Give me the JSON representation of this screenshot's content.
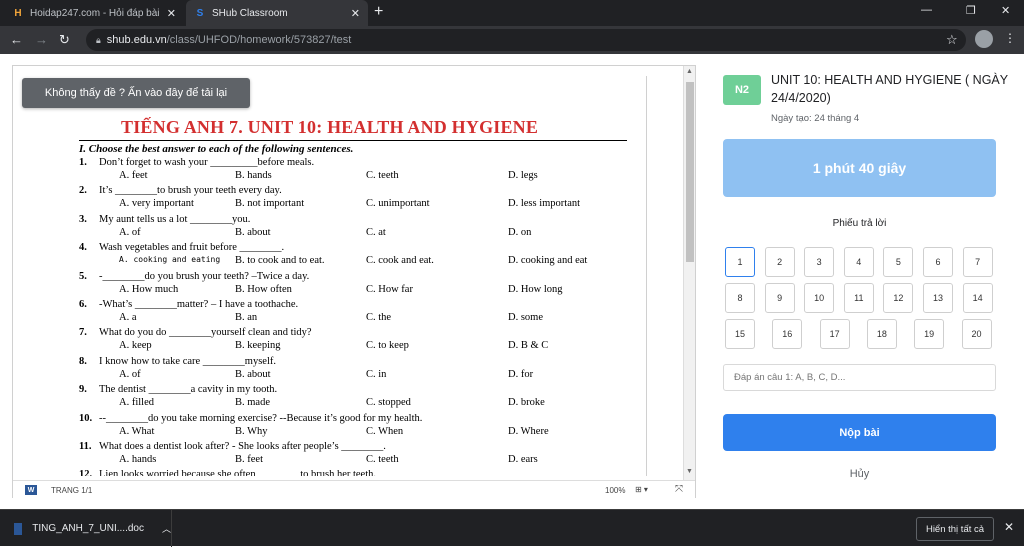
{
  "browser": {
    "tabs": [
      {
        "label": "Hoidap247.com - Hỏi đáp bài tập",
        "favicon": "H"
      },
      {
        "label": "SHub Classroom",
        "favicon": "S"
      }
    ],
    "url_domain": "shub.edu.vn",
    "url_path": "/class/UHFOD/homework/573827/test"
  },
  "viewer": {
    "reload_notice": "Không thấy đề ? Ấn vào đây để tải lại",
    "doc_title": "TIẾNG ANH 7. UNIT 10: HEALTH AND HYGIENE",
    "instruction": "I. Choose the best answer to each of the following sentences.",
    "questions": [
      {
        "num": "1.",
        "text": "Don’t forget to wash your _________before meals.",
        "options": [
          "A. feet",
          "B. hands",
          "C. teeth",
          "D. legs"
        ]
      },
      {
        "num": "2.",
        "text": "It’s ________to brush your teeth every day.",
        "options": [
          "A. very important",
          "B. not important",
          "C. unimportant",
          "D. less important"
        ]
      },
      {
        "num": "3.",
        "text": "My aunt tells us a lot ________you.",
        "options": [
          "A. of",
          "B. about",
          "C. at",
          "D. on"
        ]
      },
      {
        "num": "4.",
        "text": "Wash vegetables and fruit before ________.",
        "options": [
          "A. cooking and eating",
          "B. to cook and to eat.",
          "C. cook and eat.",
          "D. cooking and eat"
        ]
      },
      {
        "num": "5.",
        "text": "-________do you brush your teeth? –Twice a day.",
        "options": [
          "A. How much",
          "B. How often",
          "C. How far",
          "D. How long"
        ]
      },
      {
        "num": "6.",
        "text": "-What’s ________matter? – I have a toothache.",
        "options": [
          "A. a",
          "B. an",
          "C. the",
          "D. some"
        ]
      },
      {
        "num": "7.",
        "text": "What do you do ________yourself clean and tidy?",
        "options": [
          "A. keep",
          "B. keeping",
          "C. to keep",
          "D. B & C"
        ]
      },
      {
        "num": "8.",
        "text": "I know how to take care ________myself.",
        "options": [
          "A. of",
          "B. about",
          "C. in",
          "D. for"
        ]
      },
      {
        "num": "9.",
        "text": "The dentist ________a cavity in my tooth.",
        "options": [
          "A. filled",
          "B. made",
          "C. stopped",
          "D. broke"
        ]
      },
      {
        "num": "10.",
        "text": "--________do you take morning exercise? --Because it’s good for my health.",
        "options": [
          "A. What",
          "B. Why",
          "C. When",
          "D. Where"
        ]
      },
      {
        "num": "11.",
        "text": "What does a dentist look after? - She looks after people’s ________.",
        "options": [
          "A. hands",
          "B. feet",
          "C. teeth",
          "D. ears"
        ]
      },
      {
        "num": "12.",
        "text": "Lien looks worried because she often ________to brush her teeth.",
        "options": []
      }
    ],
    "page_indicator": "TRANG 1/1",
    "zoom": "100%"
  },
  "panel": {
    "badge": "N2",
    "title": "UNIT 10: HEALTH AND HYGIENE ( NGÀY 24/4/2020)",
    "created": "Ngày tạo: 24 tháng 4",
    "timer": "1 phút 40 giây",
    "sheet_label": "Phiếu trả lời",
    "answer_numbers": [
      "1",
      "2",
      "3",
      "4",
      "5",
      "6",
      "7",
      "8",
      "9",
      "10",
      "11",
      "12",
      "13",
      "14",
      "15",
      "16",
      "17",
      "18",
      "19",
      "20"
    ],
    "answer_placeholder": "Đáp án câu 1: A, B, C, D...",
    "submit_label": "Nộp bài",
    "cancel_label": "Hủy"
  },
  "downloads": {
    "file_name": "TING_ANH_7_UNI....doc",
    "show_all": "Hiển thị tất cả"
  },
  "colors": {
    "accent": "#2f80ed",
    "timer": "#8fc1f2",
    "badge": "#6fcf97",
    "title_red": "#d32f2f"
  }
}
